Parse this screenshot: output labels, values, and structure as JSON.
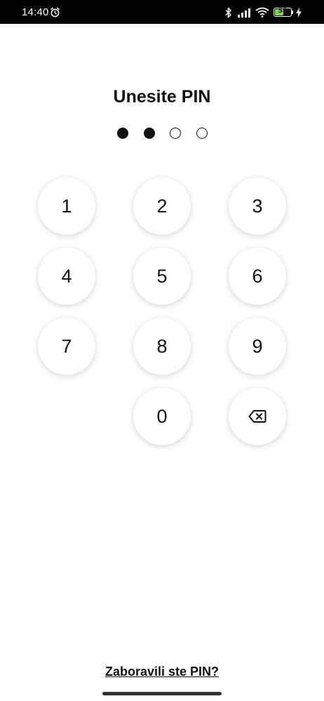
{
  "status_bar": {
    "time": "14:40",
    "battery_level": "55",
    "battery_percent": 55,
    "icons": [
      "alarm-icon",
      "bluetooth-icon",
      "signal-icon",
      "wifi-icon",
      "battery-icon",
      "charging-bolt-icon"
    ]
  },
  "title": "Unesite PIN",
  "pin": {
    "length": 4,
    "entered": 2
  },
  "keypad": {
    "keys": [
      "1",
      "2",
      "3",
      "4",
      "5",
      "6",
      "7",
      "8",
      "9",
      "0"
    ],
    "backspace_icon": "backspace-icon"
  },
  "forgot_pin_label": "Zaboravili ste PIN?",
  "colors": {
    "text": "#111111",
    "background": "#ffffff",
    "status_bar": "#000000",
    "battery": "#7bd64a"
  }
}
